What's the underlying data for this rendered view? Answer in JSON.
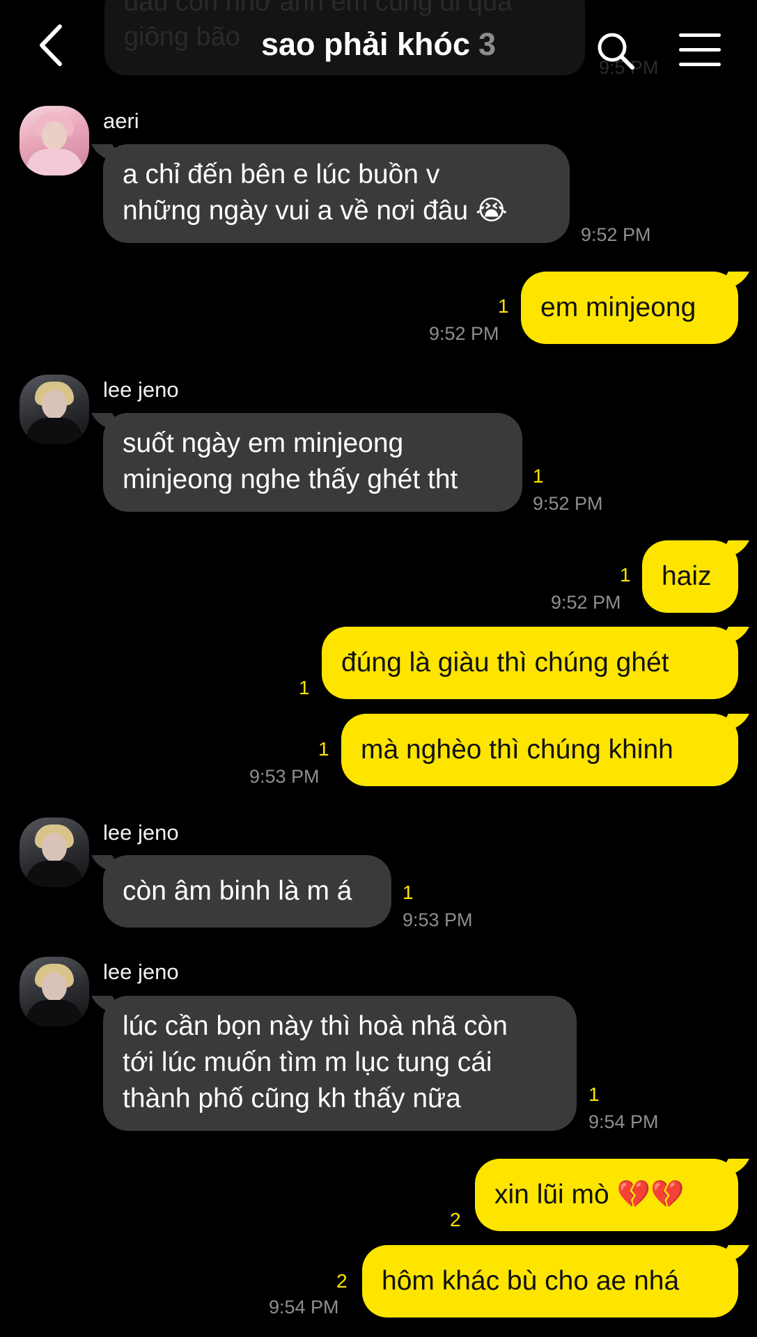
{
  "background_message": {
    "text_line1": "đâu còn nhớ anh em cùng đi qua",
    "text_line2": "giông bão",
    "time": "9:5 PM"
  },
  "header": {
    "title": "sao phải khóc",
    "member_count": "3"
  },
  "messages": [
    {
      "sender": "aeri",
      "lines": [
        "a chỉ đến bên e lúc buồn v",
        "những ngày vui a về nơi đâu 😭"
      ],
      "unread": "",
      "time": "9:52 PM"
    },
    {
      "lines": [
        "em minjeong"
      ],
      "unread": "1",
      "time": "9:52 PM"
    },
    {
      "sender": "lee jeno",
      "lines": [
        "suốt ngày em minjeong",
        "minjeong nghe thấy ghét tht"
      ],
      "unread": "1",
      "time": "9:52 PM"
    },
    {
      "lines": [
        "haiz"
      ],
      "unread": "1",
      "time": "9:52 PM"
    },
    {
      "lines": [
        "đúng là giàu thì chúng ghét"
      ],
      "unread": "1",
      "time": ""
    },
    {
      "lines": [
        "mà nghèo thì chúng khinh"
      ],
      "unread": "1",
      "time": "9:53 PM"
    },
    {
      "sender": "lee jeno",
      "lines": [
        "còn âm binh là m á"
      ],
      "unread": "1",
      "time": "9:53 PM"
    },
    {
      "sender": "lee jeno",
      "lines": [
        "lúc cần bọn này thì hoà nhã còn",
        "tới lúc muốn tìm m lục tung cái",
        "thành phố cũng kh thấy nữa"
      ],
      "unread": "1",
      "time": "9:54 PM"
    },
    {
      "lines": [
        "xin lũi mò 💔💔"
      ],
      "unread": "2",
      "time": ""
    },
    {
      "lines": [
        "hôm khác bù cho ae nhá"
      ],
      "unread": "2",
      "time": "9:54 PM"
    }
  ],
  "colors": {
    "incoming_bubble": "#3a3a3c",
    "outgoing_bubble": "#fee500",
    "unread_count": "#fee500",
    "timestamp": "#8e8e93"
  }
}
